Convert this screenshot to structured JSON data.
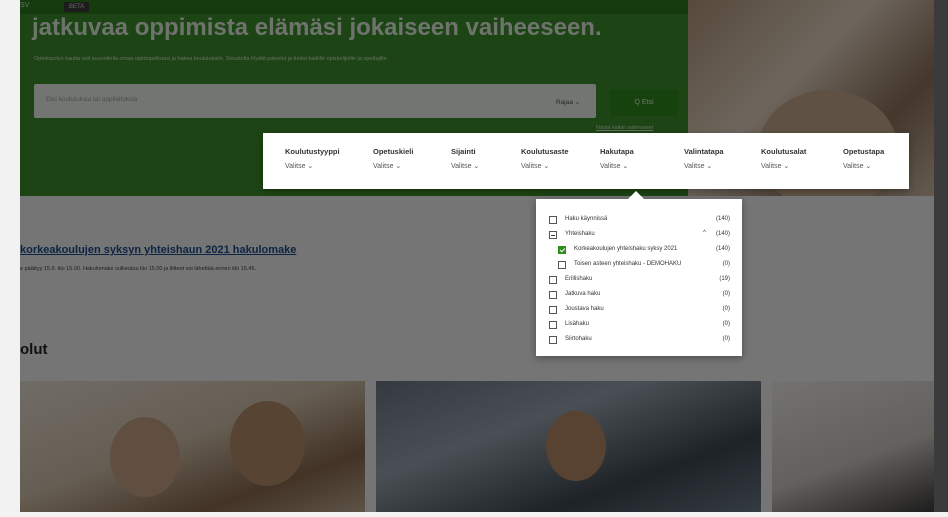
{
  "header": {
    "site_label": "SV",
    "badge": "BETA",
    "title": "jatkuvaa oppimista elämäsi jokaiseen vaiheeseen.",
    "subtitle": "Opintopolun kautta voit suunnitella omaa opintopolkuasi ja hakea koulutuksiin. Sivustolta löydät palvelut ja tiedot kaikille opiskelijoille ja opettajille."
  },
  "search": {
    "placeholder": "Etsi koulutuksia tai oppilaitoksia",
    "rajaa_label": "Rajaa ⌄",
    "search_button": "Q Etsi",
    "link": "Näytä kaikki valinnaiset"
  },
  "filters": [
    {
      "label": "Koulutustyyppi",
      "value": "Valitse ⌄"
    },
    {
      "label": "Opetuskieli",
      "value": "Valitse ⌄"
    },
    {
      "label": "Sijainti",
      "value": "Valitse ⌄"
    },
    {
      "label": "Koulutusaste",
      "value": "Valitse ⌄"
    },
    {
      "label": "Hakutapa",
      "value": "Valitse ⌄"
    },
    {
      "label": "Valintatapa",
      "value": "Valitse ⌄"
    },
    {
      "label": "Koulutusalat",
      "value": "Valitse ⌄"
    },
    {
      "label": "Opetustapa",
      "value": "Valitse ⌄"
    }
  ],
  "hakutapa_dropdown": {
    "options": [
      {
        "label": "Haku käynnissä",
        "count": "(140)",
        "state": "unchecked",
        "indent": 0
      },
      {
        "label": "Yhteishaku",
        "count": "(140)",
        "state": "minus",
        "indent": 0,
        "chevron": "^"
      },
      {
        "label": "Korkeakoulujen yhteishaku syksy 2021",
        "count": "(140)",
        "state": "checked",
        "indent": 1
      },
      {
        "label": "Toisen asteen yhteishaku - DEMOHAKU",
        "count": "(0)",
        "state": "unchecked",
        "indent": 1
      },
      {
        "label": "Erillishaku",
        "count": "(19)",
        "state": "unchecked",
        "indent": 0
      },
      {
        "label": "Jatkuva haku",
        "count": "(0)",
        "state": "unchecked",
        "indent": 0
      },
      {
        "label": "Joustava haku",
        "count": "(0)",
        "state": "unchecked",
        "indent": 0
      },
      {
        "label": "Lisähaku",
        "count": "(0)",
        "state": "unchecked",
        "indent": 0
      },
      {
        "label": "Siirtohaku",
        "count": "(0)",
        "state": "unchecked",
        "indent": 0
      }
    ]
  },
  "content": {
    "notice_title": "korkeakoulujen syksyn yhteishaun 2021 hakulomake",
    "notice_sub": "e päättyy 15.9. klo 15.00. Hakulomake sulkeutuu klo 15.00 ja liitteet voi lähettää ennen klo 15.45.",
    "section_heading": "olut"
  },
  "colors": {
    "brand_green": "#3d8f2a",
    "button_green": "#2f8b1c",
    "link_blue": "#1d4f8f"
  }
}
